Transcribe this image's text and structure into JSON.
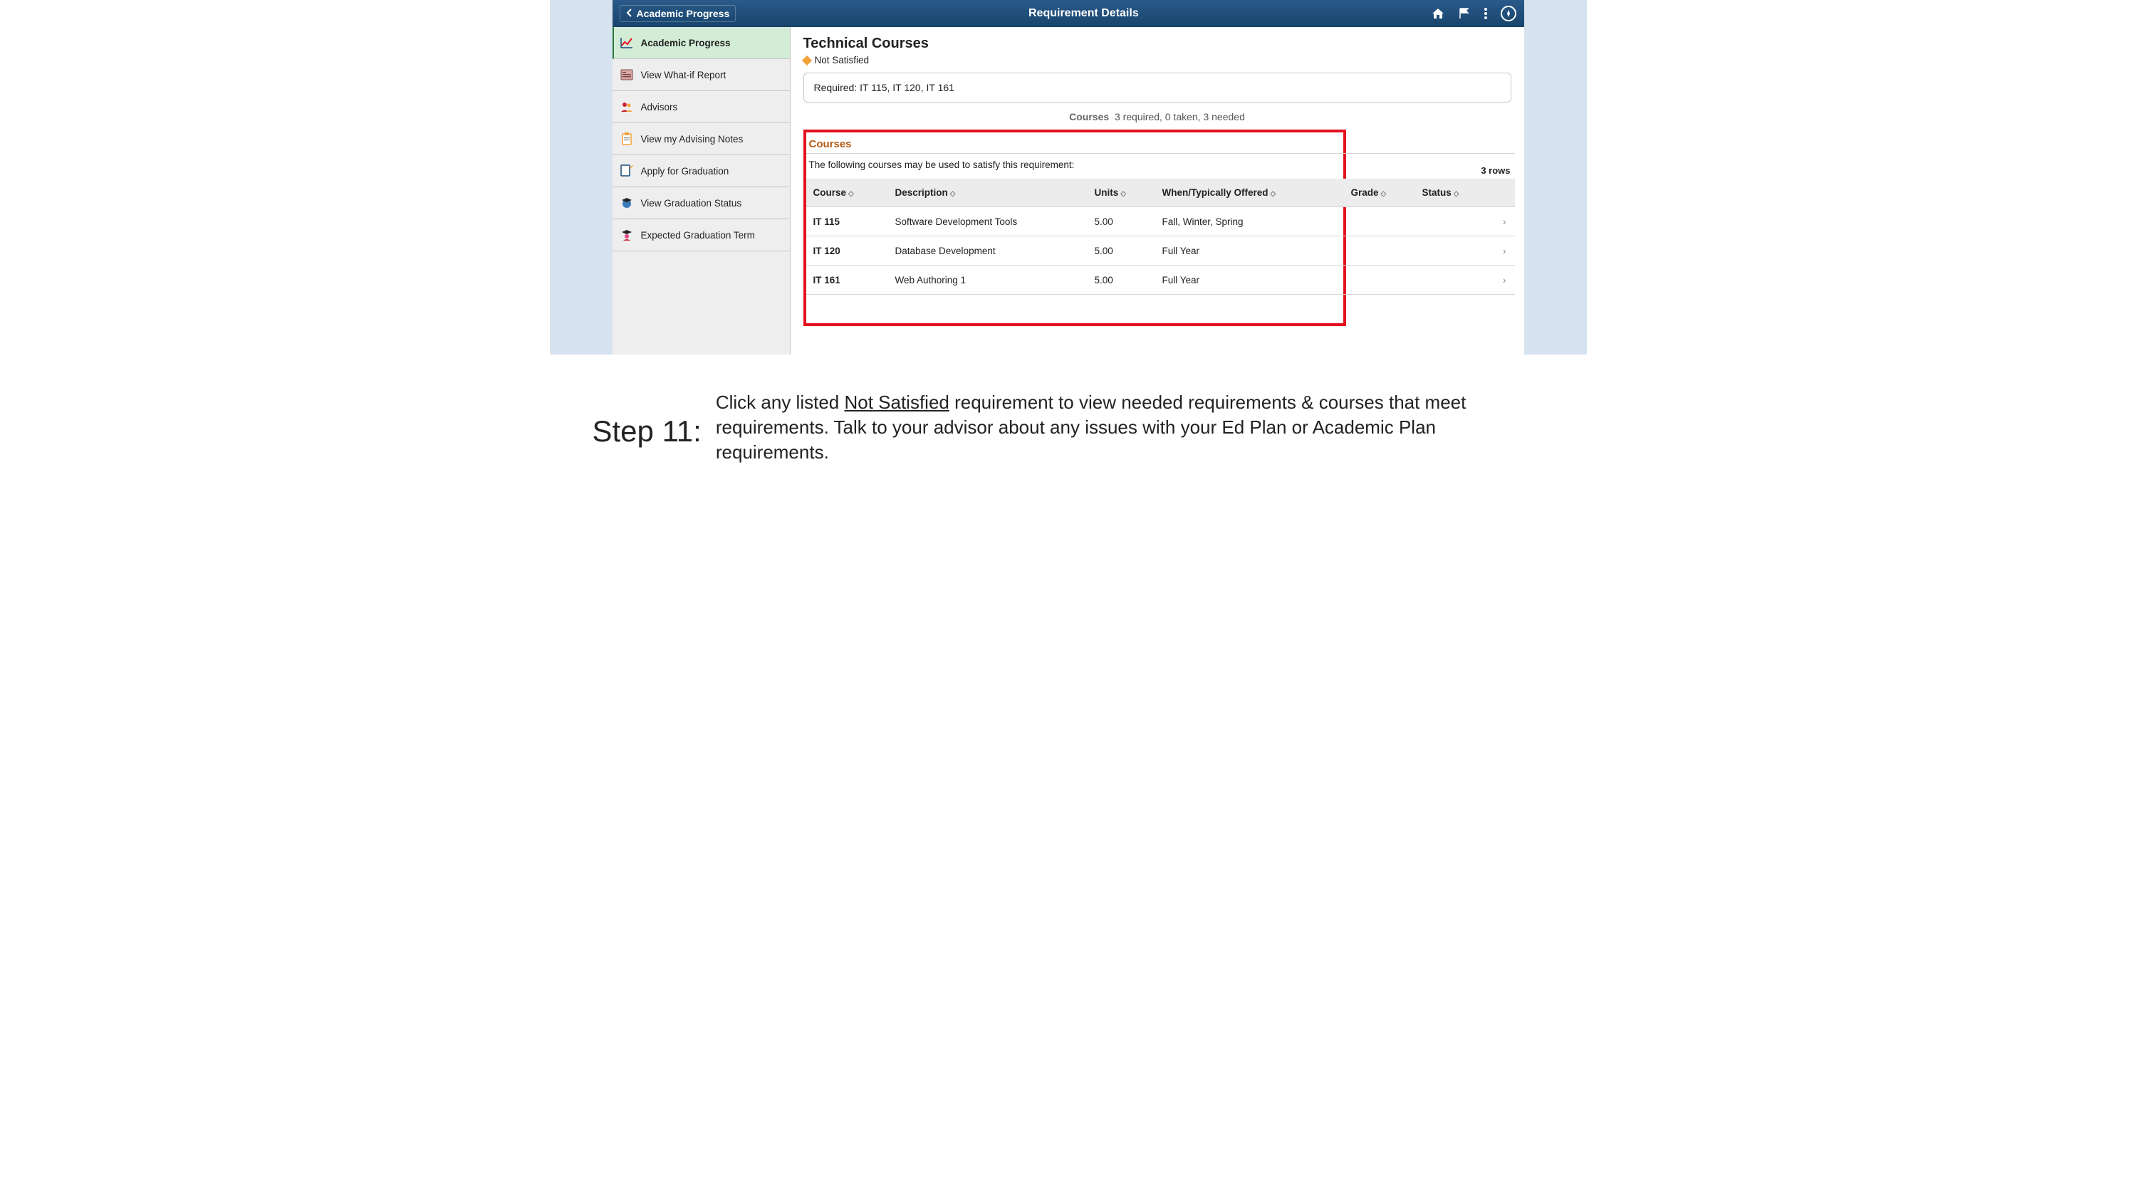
{
  "topbar": {
    "back_label": "Academic Progress",
    "title": "Requirement Details"
  },
  "sidebar": {
    "items": [
      {
        "label": "Academic Progress"
      },
      {
        "label": "View What-if Report"
      },
      {
        "label": "Advisors"
      },
      {
        "label": "View my Advising Notes"
      },
      {
        "label": "Apply for Graduation"
      },
      {
        "label": "View Graduation Status"
      },
      {
        "label": "Expected Graduation Term"
      }
    ]
  },
  "content": {
    "heading": "Technical Courses",
    "status_text": "Not Satisfied",
    "required_text": "Required: IT 115, IT 120, IT 161",
    "summary_label": "Courses",
    "summary_value": "3 required, 0 taken, 3 needed",
    "section_heading": "Courses",
    "section_desc": "The following courses may be used to satisfy this requirement:",
    "rows_label": "3 rows",
    "columns": {
      "course": "Course",
      "description": "Description",
      "units": "Units",
      "offered": "When/Typically Offered",
      "grade": "Grade",
      "status": "Status"
    },
    "rows": [
      {
        "course": "IT 115",
        "description": "Software Development Tools",
        "units": "5.00",
        "offered": "Fall, Winter, Spring",
        "grade": "",
        "status": ""
      },
      {
        "course": "IT 120",
        "description": "Database Development",
        "units": "5.00",
        "offered": "Full Year",
        "grade": "",
        "status": ""
      },
      {
        "course": "IT 161",
        "description": "Web Authoring 1",
        "units": "5.00",
        "offered": "Full Year",
        "grade": "",
        "status": ""
      }
    ]
  },
  "step": {
    "label": "Step 11:",
    "text_pre": "Click any listed ",
    "text_underline": "Not Satisfied",
    "text_post": " requirement to view needed requirements & courses that meet requirements. Talk to your advisor about any issues with your Ed Plan or Academic Plan requirements."
  }
}
